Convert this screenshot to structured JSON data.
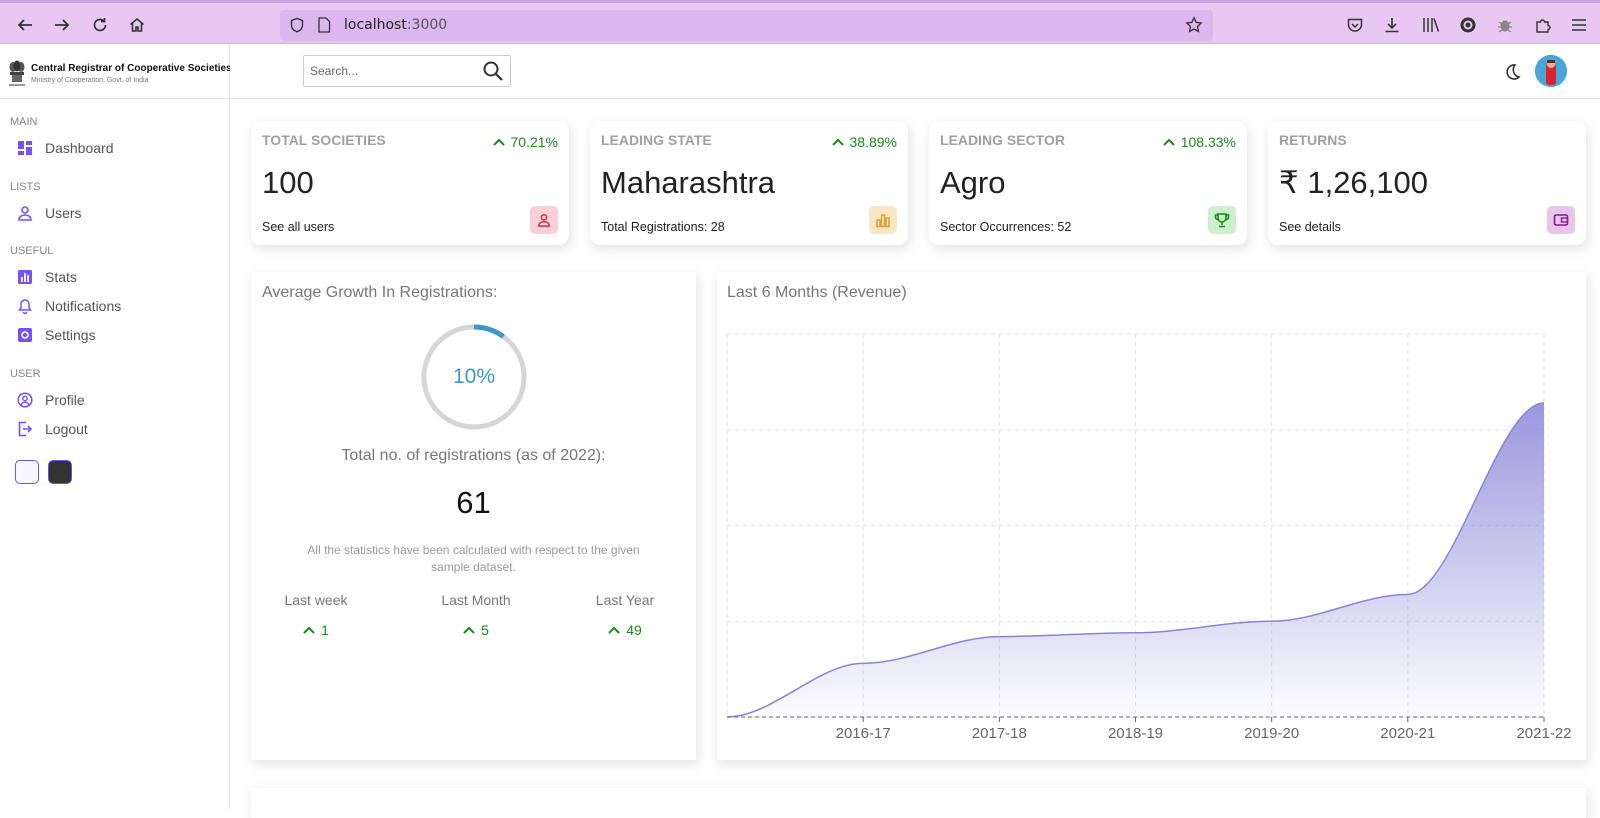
{
  "browser": {
    "url_host": "localhost",
    "url_port": ":3000"
  },
  "sidebar": {
    "logo_title": "Central Registrar of Cooperative Societies",
    "logo_subtitle": "Ministry of Cooperation, Govt. of India",
    "sections": {
      "main": "MAIN",
      "lists": "LISTS",
      "useful": "USEFUL",
      "user": "USER"
    },
    "items": {
      "dashboard": "Dashboard",
      "users": "Users",
      "stats": "Stats",
      "notifications": "Notifications",
      "settings": "Settings",
      "profile": "Profile",
      "logout": "Logout"
    },
    "accent_color": "#7451f8"
  },
  "topbar": {
    "search_placeholder": "Search..."
  },
  "widgets": [
    {
      "title": "TOTAL SOCIETIES",
      "percent": "70.21%",
      "value": "100",
      "link": "See all users",
      "icon": "person-outline-icon",
      "icon_bg": "#fbd0d6",
      "icon_color": "#d1304a"
    },
    {
      "title": "LEADING STATE",
      "percent": "38.89%",
      "value": "Maharashtra",
      "link": "Total Registrations: 28",
      "icon": "bar-chart-outline-icon",
      "icon_bg": "#f8e6c5",
      "icon_color": "#d4a33a"
    },
    {
      "title": "LEADING SECTOR",
      "percent": "108.33%",
      "value": "Agro",
      "link": "Sector Occurrences: 52",
      "icon": "trophy-icon",
      "icon_bg": "#ccefcc",
      "icon_color": "#1b8a1b"
    },
    {
      "title": "RETURNS",
      "percent": "",
      "value": "₹ 1,26,100",
      "link": "See details",
      "icon": "wallet-icon",
      "icon_bg": "#e7c6ea",
      "icon_color": "#8a1b90"
    }
  ],
  "featured": {
    "title": "Average Growth In Registrations:",
    "progress_percent": 10,
    "progress_label": "10%",
    "subtitle": "Total no. of registrations (as of 2022):",
    "amount": "61",
    "description": "All the statistics have been calculated with respect to the given sample dataset.",
    "summary": [
      {
        "title": "Last week",
        "value": "1"
      },
      {
        "title": "Last Month",
        "value": "5"
      },
      {
        "title": "Last Year",
        "value": "49"
      }
    ]
  },
  "chart_data": {
    "type": "area",
    "title": "Last 6 Months (Revenue)",
    "categories": [
      "",
      "2016-17",
      "2017-18",
      "2018-19",
      "2019-20",
      "2020-21",
      "2021-22"
    ],
    "values": [
      0,
      14,
      21,
      22,
      25,
      32,
      82
    ],
    "ylim": [
      0,
      100
    ],
    "grid": true,
    "color": "#8884d8"
  }
}
